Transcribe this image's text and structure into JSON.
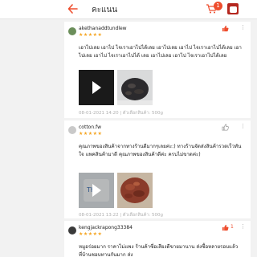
{
  "header": {
    "title": "คะแนน",
    "cart_badge": "1"
  },
  "reviews": [
    {
      "username": "akethanaddtundlew",
      "avatar_color": "#6b8e5a",
      "stars": "★★★★★",
      "likes": "",
      "more": "⋮",
      "text": "เอาไปเลย เอาไป ไจเราเอาไปได้เลย เอาไปเลย เอาไป ไจเราเอาไปได้เลย เอาไปเลย เอาไป ไจเราเอาไปได้ เลย เอาไปเลย เอาไป ไจเราเอาไปได้เลย",
      "meta": "08-01-2021 14:20 | ตัวเลือกสินค้า: 500g"
    },
    {
      "username": "cotton.fw",
      "avatar_color": "#c9c9c9",
      "stars": "★★★★★",
      "likes": "",
      "more": "⋮",
      "text": "คุณภาพของสินค้าจากทางร้านดีมากๆเลยค่ะ:) ทางร้านจัดส่งสินค้ารวดเร็วทันใจ แพคสินค้ามาดี คุณภาพของสินค้าดีค่ะ ครบไม่ขาดค่ะ)",
      "meta": "08-01-2021 13:22 | ตัวเลือกสินค้า: 500g"
    },
    {
      "username": "kengjackrapong33384",
      "avatar_color": "#3a3a3a",
      "stars": "★★★★★",
      "likes": "1",
      "more": "⋮",
      "text": "หมูอร่อยมาก ราคาไม่แพง ร้านค้าซื่อเสียงดีขายมานาน ส่งซื้อหลายรอบแล้ว ที่บ้านชอบทานกันมาก ส่ง"
    }
  ],
  "colors": {
    "accent": "#ee4d2d",
    "star": "#f5a623"
  }
}
